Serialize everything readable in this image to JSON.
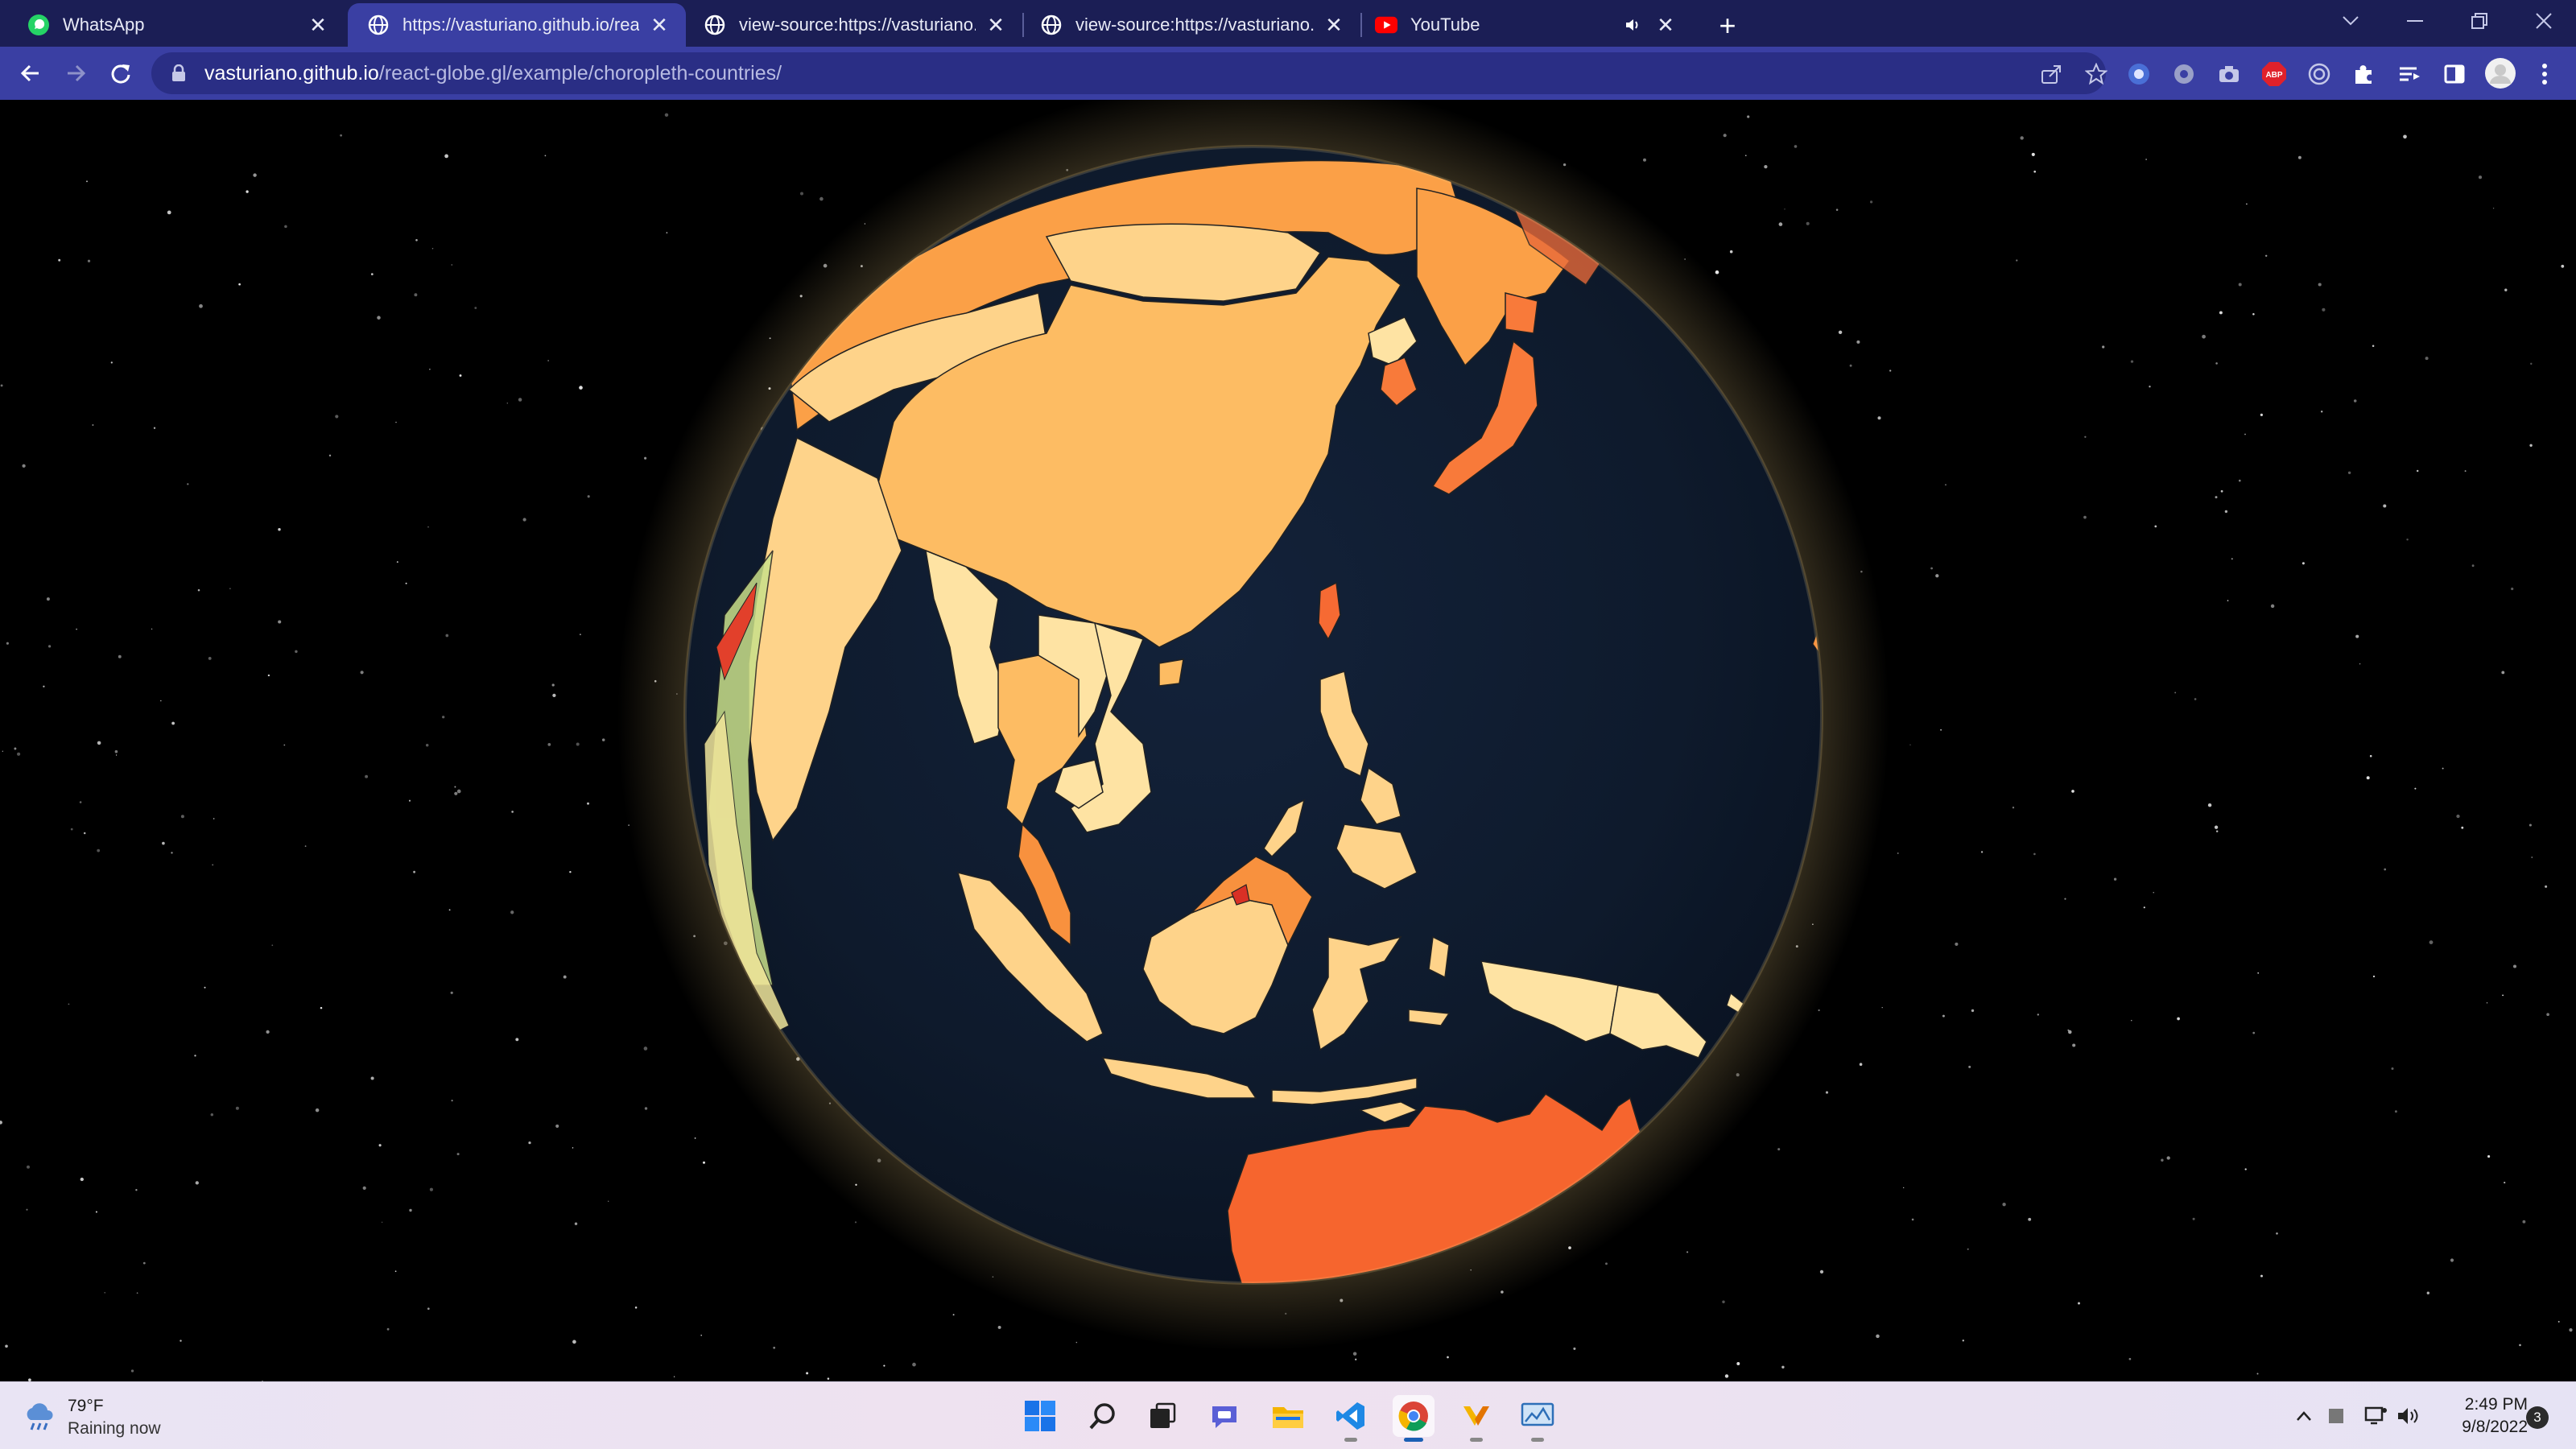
{
  "tabs": [
    {
      "title": "WhatsApp",
      "icon": "whatsapp-icon",
      "active": false
    },
    {
      "title": "https://vasturiano.github.io/react-globe.gl/example/choropleth-countries/",
      "icon": "globe-icon",
      "active": true
    },
    {
      "title": "view-source:https://vasturiano.github.io/react-globe.gl/",
      "icon": "globe-icon",
      "active": false
    },
    {
      "title": "view-source:https://vasturiano.github.io/react-globe.gl/",
      "icon": "globe-icon",
      "active": false
    },
    {
      "title": "YouTube",
      "icon": "youtube-icon",
      "active": false,
      "muted_audio": true
    }
  ],
  "address_bar": {
    "domain": "vasturiano.github.io",
    "path": "/react-globe.gl/example/choropleth-countries/"
  },
  "extensions": [
    "extension-blue-icon",
    "extension-gray-icon",
    "camera-icon",
    "adblock-plus-icon",
    "target-icon",
    "puzzle-icon",
    "reading-list-icon",
    "side-panel-icon",
    "profile-avatar",
    "menu-icon"
  ],
  "adblock_badge": "ABP",
  "globe": {
    "colors": {
      "ocean": "#0e1a2c",
      "glow": "#f6d58a",
      "australia": "#f6652e",
      "china": "#fdbc63",
      "japan": "#f87a3a",
      "russia": "#fba047",
      "pale": "#fee3a3"
    }
  },
  "taskbar": {
    "weather_temp": "79°F",
    "weather_condition": "Raining now",
    "apps": [
      "windows-start-icon",
      "search-icon",
      "task-view-icon",
      "teams-chat-icon",
      "file-explorer-icon",
      "vscode-icon",
      "chrome-icon",
      "app-icon",
      "monitor-app-icon"
    ],
    "time": "2:49 PM",
    "date": "9/8/2022",
    "notifications": "3"
  }
}
